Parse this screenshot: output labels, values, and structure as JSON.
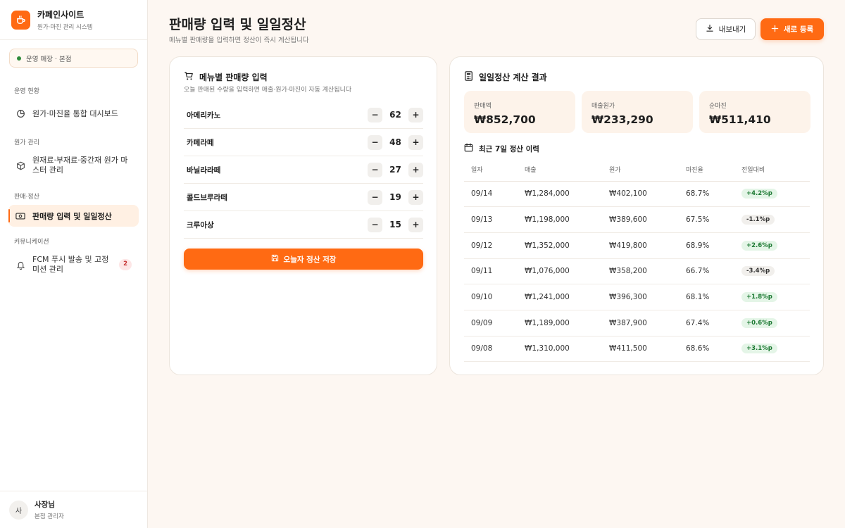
{
  "app": {
    "name": "카페인사이트",
    "subtitle": "원가·마진 관리 시스템"
  },
  "store": {
    "label": "운영 매장 · 본점"
  },
  "nav": {
    "sections": [
      {
        "title": "운영 현황",
        "items": [
          {
            "label": "원가·마진율 통합 대시보드",
            "icon": "chart-icon"
          }
        ]
      },
      {
        "title": "원가 관리",
        "items": [
          {
            "label": "원재료·부재료·중간재 원가 마스터 관리",
            "icon": "box-icon"
          }
        ]
      },
      {
        "title": "판매·정산",
        "items": [
          {
            "label": "판매량 입력 및 일일정산",
            "icon": "cash-icon",
            "active": true
          }
        ]
      },
      {
        "title": "커뮤니케이션",
        "items": [
          {
            "label": "FCM 푸시 발송 및 고정 미션 관리",
            "icon": "bell-icon",
            "badge": "2"
          }
        ]
      }
    ]
  },
  "user": {
    "initial": "사",
    "name": "사장님",
    "role": "본점 관리자"
  },
  "header": {
    "title": "판매량 입력 및 일일정산",
    "subtitle": "메뉴별 판매량을 입력하면 정산이 즉시 계산됩니다",
    "export_label": "내보내기",
    "new_label": "새로 등록"
  },
  "sales_card": {
    "title": "메뉴별 판매량 입력",
    "description": "오늘 판매된 수량을 입력하면 매출·원가·마진이 자동 계산됩니다",
    "items": [
      {
        "name": "아메리카노",
        "qty": "62"
      },
      {
        "name": "카페라떼",
        "qty": "48"
      },
      {
        "name": "바닐라라떼",
        "qty": "27"
      },
      {
        "name": "콜드브루라떼",
        "qty": "19"
      },
      {
        "name": "크루아상",
        "qty": "15"
      }
    ],
    "minus": "−",
    "plus": "+",
    "save_label": "오늘자 정산 저장"
  },
  "settle_card": {
    "title": "일일정산 계산 결과",
    "metrics": [
      {
        "label": "판매액",
        "value": "₩852,700"
      },
      {
        "label": "매출원가",
        "value": "₩233,290"
      },
      {
        "label": "순마진",
        "value": "₩511,410"
      }
    ],
    "history_title": "최근 7일 정산 이력",
    "columns": [
      "일자",
      "매출",
      "원가",
      "마진율",
      "전일대비"
    ],
    "rows": [
      {
        "date": "09/14",
        "sales": "₩1,284,000",
        "cost": "₩402,100",
        "margin": "68.7%",
        "delta": "+4.2%p",
        "trend": "up"
      },
      {
        "date": "09/13",
        "sales": "₩1,198,000",
        "cost": "₩389,600",
        "margin": "67.5%",
        "delta": "-1.1%p",
        "trend": "down"
      },
      {
        "date": "09/12",
        "sales": "₩1,352,000",
        "cost": "₩419,800",
        "margin": "68.9%",
        "delta": "+2.6%p",
        "trend": "up"
      },
      {
        "date": "09/11",
        "sales": "₩1,076,000",
        "cost": "₩358,200",
        "margin": "66.7%",
        "delta": "-3.4%p",
        "trend": "down"
      },
      {
        "date": "09/10",
        "sales": "₩1,241,000",
        "cost": "₩396,300",
        "margin": "68.1%",
        "delta": "+1.8%p",
        "trend": "up"
      },
      {
        "date": "09/09",
        "sales": "₩1,189,000",
        "cost": "₩387,900",
        "margin": "67.4%",
        "delta": "+0.6%p",
        "trend": "up"
      },
      {
        "date": "09/08",
        "sales": "₩1,310,000",
        "cost": "₩411,500",
        "margin": "68.6%",
        "delta": "+3.1%p",
        "trend": "up"
      }
    ]
  },
  "colors": {
    "accent": "#ff6a13",
    "positive_bg": "#e4f5e7",
    "positive_text": "#1e7a34"
  }
}
